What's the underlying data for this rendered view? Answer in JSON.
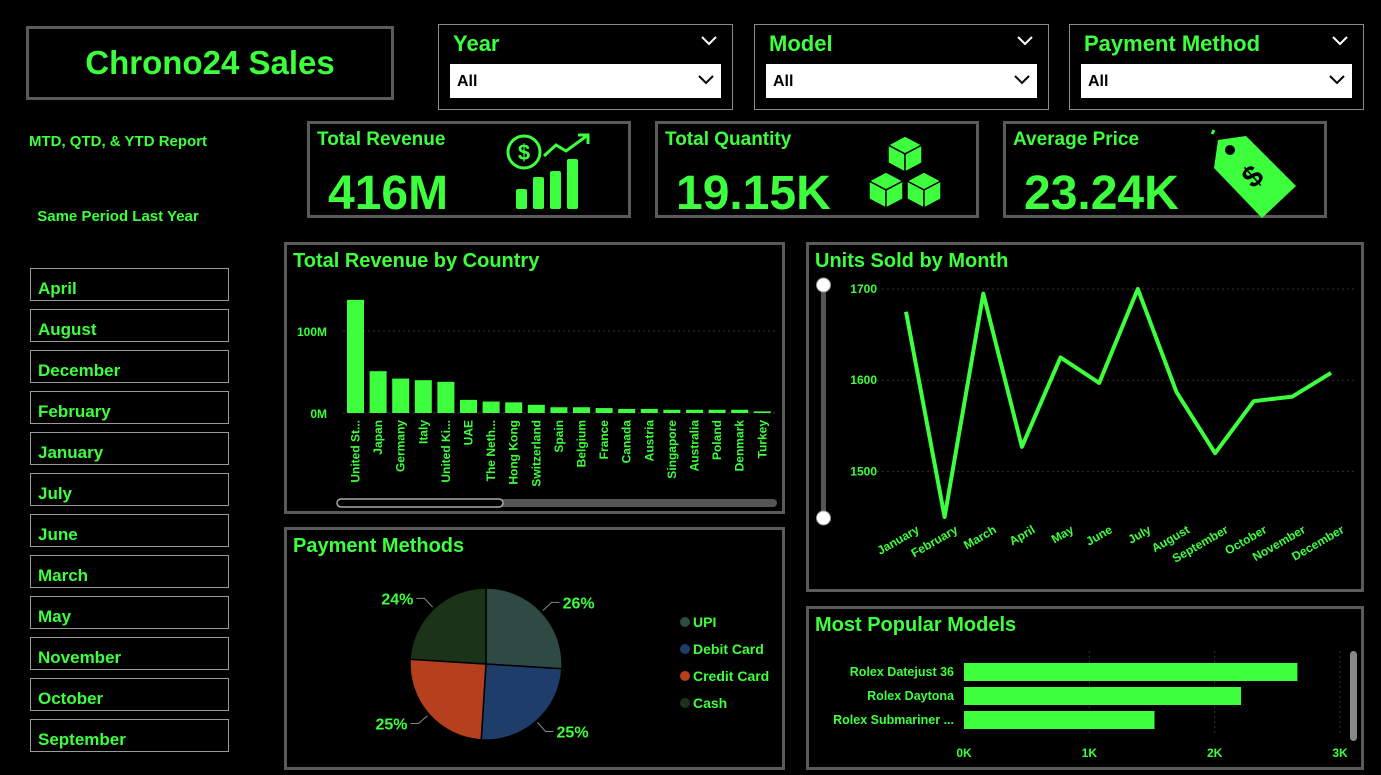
{
  "title": "Chrono24 Sales",
  "slicers": [
    {
      "label": "Year",
      "value": "All"
    },
    {
      "label": "Model",
      "value": "All"
    },
    {
      "label": "Payment Method",
      "value": "All"
    }
  ],
  "side": {
    "report_label": "MTD, QTD, & YTD Report",
    "sply_label": "Same Period Last Year",
    "months": [
      "April",
      "August",
      "December",
      "February",
      "January",
      "July",
      "June",
      "March",
      "May",
      "November",
      "October",
      "September"
    ]
  },
  "kpis": [
    {
      "label": "Total Revenue",
      "value": "416M",
      "icon": "revenue-chart-icon"
    },
    {
      "label": "Total Quantity",
      "value": "19.15K",
      "icon": "boxes-icon"
    },
    {
      "label": "Average Price",
      "value": "23.24K",
      "icon": "price-tag-icon"
    }
  ],
  "colors": {
    "accent": "#3dff3d",
    "background": "#000000",
    "border": "#5a5a5a",
    "pie": [
      "#2f4a42",
      "#1e3d6b",
      "#b5401e",
      "#1b3419"
    ]
  },
  "panels": {
    "revenue_by_country": "Total Revenue by Country",
    "units_by_month": "Units Sold by Month",
    "payment_methods": "Payment Methods",
    "popular_models": "Most Popular Models"
  },
  "chart_data": [
    {
      "type": "bar",
      "title": "Total Revenue by Country",
      "categories": [
        "United St...",
        "Japan",
        "Germany",
        "Italy",
        "United Ki...",
        "UAE",
        "The Neth...",
        "Hong Kong",
        "Switzerland",
        "Spain",
        "Belgium",
        "France",
        "Canada",
        "Austria",
        "Singapore",
        "Australia",
        "Poland",
        "Denmark",
        "Turkey"
      ],
      "values": [
        138,
        51,
        42,
        40,
        38,
        16,
        14,
        13,
        10,
        7,
        7,
        6,
        5,
        5,
        4,
        4,
        4,
        4,
        2
      ],
      "y_ticks": [
        {
          "value": 0,
          "label": "0M"
        },
        {
          "value": 100,
          "label": "100M"
        }
      ],
      "ylim": [
        0,
        150
      ],
      "grid": true
    },
    {
      "type": "line",
      "title": "Units Sold by Month",
      "categories": [
        "January",
        "February",
        "March",
        "April",
        "May",
        "June",
        "July",
        "August",
        "September",
        "October",
        "November",
        "December"
      ],
      "values": [
        1675,
        1450,
        1695,
        1527,
        1625,
        1597,
        1700,
        1587,
        1520,
        1577,
        1582,
        1608
      ],
      "y_ticks": [
        1500,
        1600,
        1700
      ],
      "ylim": [
        1450,
        1700
      ],
      "grid": true
    },
    {
      "type": "pie",
      "title": "Payment Methods",
      "series": [
        {
          "name": "UPI",
          "value": 26,
          "label": "26%"
        },
        {
          "name": "Debit Card",
          "value": 25,
          "label": "25%"
        },
        {
          "name": "Credit Card",
          "value": 25,
          "label": "25%"
        },
        {
          "name": "Cash",
          "value": 24,
          "label": "24%"
        }
      ],
      "legend": "right"
    },
    {
      "type": "bar",
      "orientation": "horizontal",
      "title": "Most Popular Models",
      "categories": [
        "Rolex Datejust 36",
        "Rolex Daytona",
        "Rolex Submariner ..."
      ],
      "values": [
        2660,
        2210,
        1520
      ],
      "x_ticks": [
        {
          "value": 0,
          "label": "0K"
        },
        {
          "value": 1000,
          "label": "1K"
        },
        {
          "value": 2000,
          "label": "2K"
        },
        {
          "value": 3000,
          "label": "3K"
        }
      ],
      "xlim": [
        0,
        3000
      ],
      "grid": true
    }
  ]
}
